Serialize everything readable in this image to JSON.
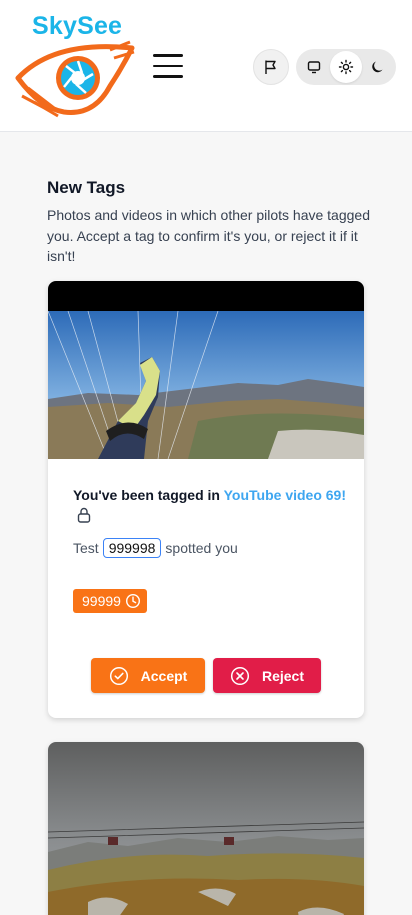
{
  "header": {
    "logo_text": "SkySee"
  },
  "section": {
    "title": "New Tags",
    "description": "Photos and videos in which other pilots have tagged you. Accept a tag to confirm it's you, or reject it if it isn't!"
  },
  "tag_card": {
    "title_prefix": "You've been tagged in ",
    "title_link": "YouTube video 69!",
    "spotter_name": "Test",
    "spotter_id": "999998",
    "spotted_suffix": "spotted you",
    "badge_value": "99999",
    "accept_label": "Accept",
    "reject_label": "Reject"
  },
  "colors": {
    "accent_orange": "#f97316",
    "reject_red": "#e11d48",
    "link_blue": "#3ea6f0",
    "logo_blue": "#1bb5e8"
  }
}
